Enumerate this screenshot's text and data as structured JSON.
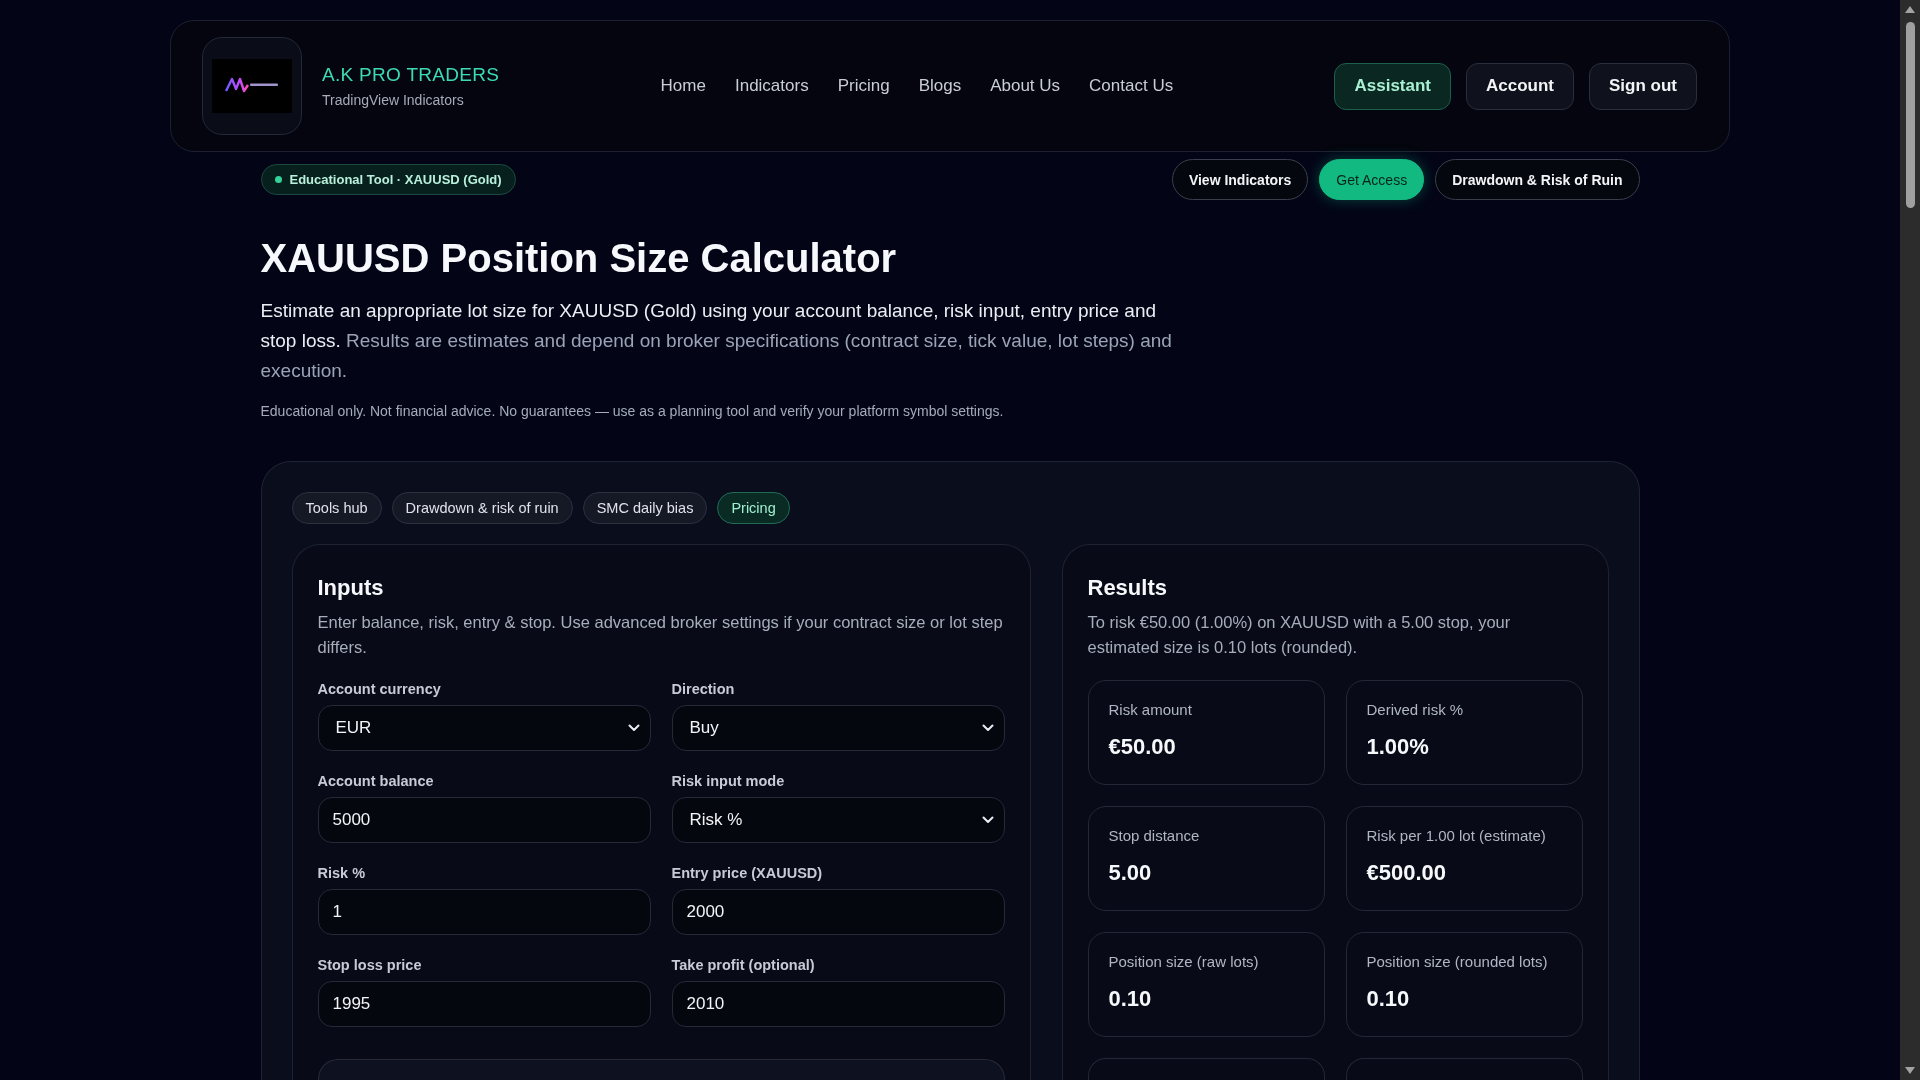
{
  "header": {
    "brand": {
      "name": "A.K PRO TRADERS",
      "tagline": "TradingView Indicators"
    },
    "nav": [
      {
        "label": "Home"
      },
      {
        "label": "Indicators"
      },
      {
        "label": "Pricing"
      },
      {
        "label": "Blogs"
      },
      {
        "label": "About Us"
      },
      {
        "label": "Contact Us"
      }
    ],
    "actions": [
      {
        "label": "Assistant",
        "kind": "accent"
      },
      {
        "label": "Account",
        "kind": "plain"
      },
      {
        "label": "Sign out",
        "kind": "plain"
      }
    ]
  },
  "tag": {
    "label": "Educational Tool · XAUUSD (Gold)"
  },
  "quick_links": [
    {
      "label": "View Indicators",
      "kind": "outline"
    },
    {
      "label": "Get Access",
      "kind": "primary"
    },
    {
      "label": "Drawdown & Risk of Ruin",
      "kind": "outline"
    }
  ],
  "title": "XAUUSD Position Size Calculator",
  "intro": {
    "lead": "Estimate an appropriate lot size for XAUUSD (Gold) using your account balance, risk input, entry price and stop loss.",
    "detail": "Results are estimates and depend on broker specifications (contract size, tick value, lot steps) and execution."
  },
  "disclaimer": "Educational only. Not financial advice. No guarantees — use as a planning tool and verify your platform symbol settings.",
  "tool_tabs": [
    {
      "label": "Tools hub",
      "selected": false
    },
    {
      "label": "Drawdown & risk of ruin",
      "selected": false
    },
    {
      "label": "SMC daily bias",
      "selected": false
    },
    {
      "label": "Pricing",
      "selected": true
    }
  ],
  "inputs": {
    "title": "Inputs",
    "description": "Enter balance, risk, entry & stop. Use advanced broker settings if your contract size or lot step differs.",
    "fields": [
      {
        "label": "Account currency",
        "kind": "select",
        "value": "EUR"
      },
      {
        "label": "Direction",
        "kind": "select",
        "value": "Buy"
      },
      {
        "label": "Account balance",
        "kind": "input",
        "value": "5000"
      },
      {
        "label": "Risk input mode",
        "kind": "select",
        "value": "Risk %"
      },
      {
        "label": "Risk %",
        "kind": "input",
        "value": "1"
      },
      {
        "label": "Entry price (XAUUSD)",
        "kind": "input",
        "value": "2000"
      },
      {
        "label": "Stop loss price",
        "kind": "input",
        "value": "1995"
      },
      {
        "label": "Take profit (optional)",
        "kind": "input",
        "value": "2010"
      }
    ]
  },
  "results": {
    "title": "Results",
    "summary": "To risk €50.00 (1.00%) on XAUUSD with a 5.00 stop, your estimated size is 0.10 lots (rounded).",
    "stats": [
      {
        "kind": "stat",
        "label": "Risk amount",
        "value": "€50.00"
      },
      {
        "kind": "stat",
        "label": "Derived risk %",
        "value": "1.00%"
      },
      {
        "kind": "stat",
        "label": "Stop distance",
        "value": "5.00"
      },
      {
        "kind": "stat",
        "label": "Risk per 1.00 lot (estimate)",
        "value": "€500.00"
      },
      {
        "kind": "stat",
        "label": "Position size (raw lots)",
        "value": "0.10"
      },
      {
        "kind": "stat",
        "label": "Position size (rounded lots)",
        "value": "0.10"
      },
      {
        "kind": "partial"
      },
      {
        "kind": "partial"
      }
    ]
  }
}
